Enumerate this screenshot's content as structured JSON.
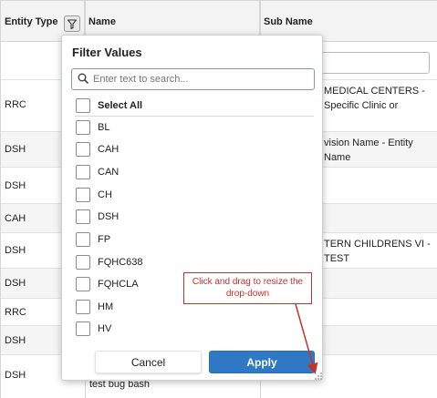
{
  "grid": {
    "headers": {
      "entity_type": "Entity Type",
      "name": "Name",
      "sub_name": "Sub Name"
    },
    "rows": [
      {
        "entity": "RRC",
        "sub": "MEDICAL CENTERS - Specific Clinic or"
      },
      {
        "entity": "DSH",
        "sub": "vision Name - Entity Name"
      },
      {
        "entity": "DSH",
        "sub": ""
      },
      {
        "entity": "CAH",
        "sub": ""
      },
      {
        "entity": "DSH",
        "sub": "TERN CHILDRENS VI - TEST"
      },
      {
        "entity": "DSH",
        "sub": ""
      },
      {
        "entity": "RRC",
        "sub": ""
      },
      {
        "entity": "DSH",
        "sub": ""
      },
      {
        "entity": "DSH",
        "sub": ""
      }
    ],
    "partial_name_text": "test bug bash"
  },
  "filter_popup": {
    "title": "Filter Values",
    "search_placeholder": "Enter text to search...",
    "select_all_label": "Select All",
    "values": [
      "BL",
      "CAH",
      "CAN",
      "CH",
      "DSH",
      "FP",
      "FQHC638",
      "FQHCLA",
      "HM",
      "HV"
    ],
    "cancel_label": "Cancel",
    "apply_label": "Apply"
  },
  "annotation": {
    "line1": "Click and drag to resize the",
    "line2": "drop-down",
    "color": "#c9302c"
  },
  "colors": {
    "apply_button": "#2f78c5",
    "header_bg": "#f3f3f3",
    "alt_row_bg": "#f5f5f5"
  }
}
